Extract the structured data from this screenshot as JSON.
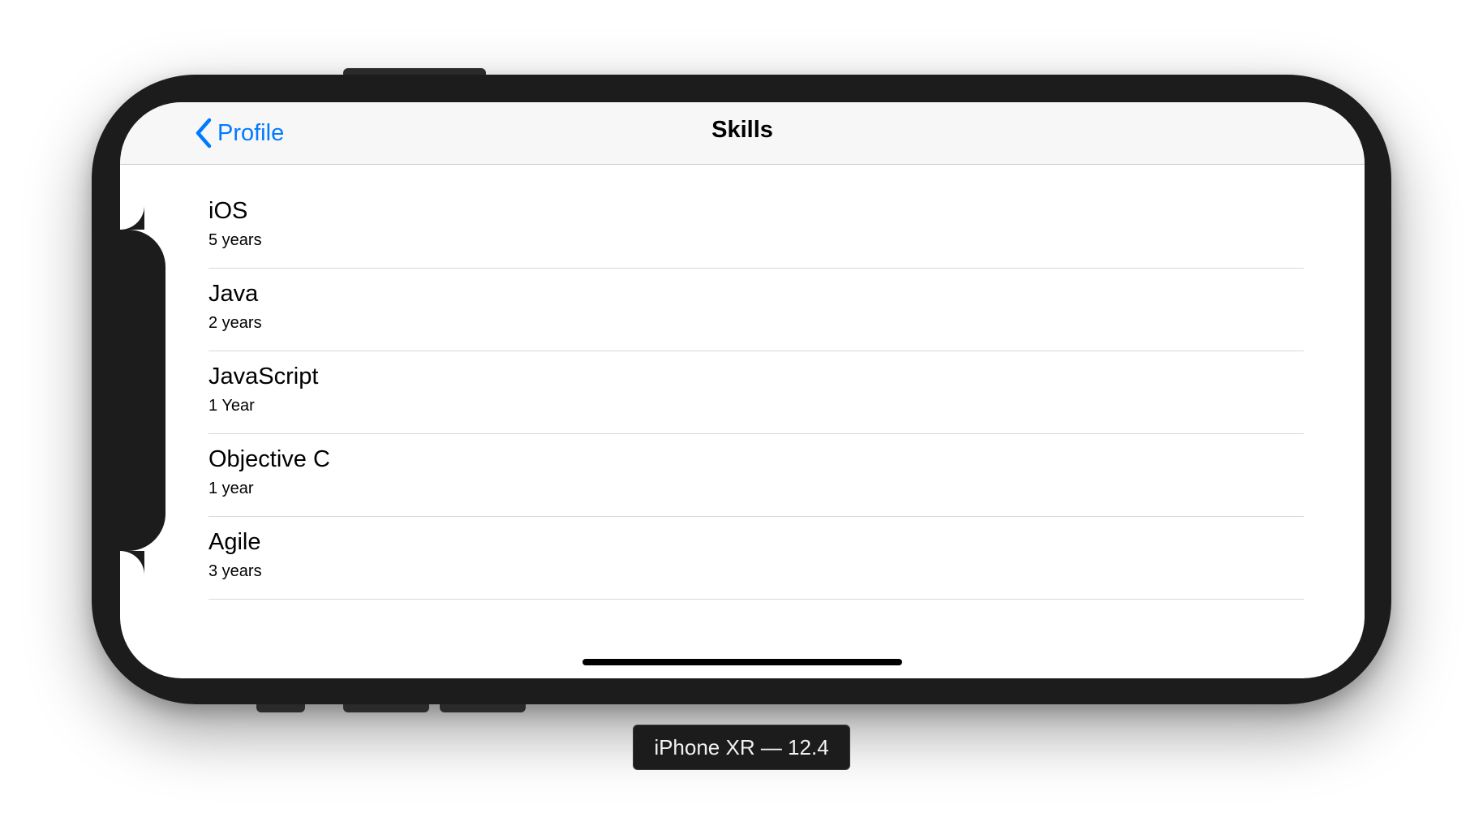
{
  "nav": {
    "back_label": "Profile",
    "title": "Skills"
  },
  "skills": [
    {
      "name": "iOS",
      "detail": "5 years"
    },
    {
      "name": "Java",
      "detail": "2 years"
    },
    {
      "name": "JavaScript",
      "detail": "1 Year"
    },
    {
      "name": "Objective C",
      "detail": "1 year"
    },
    {
      "name": "Agile",
      "detail": "3 years"
    }
  ],
  "device_label": "iPhone XR — 12.4",
  "colors": {
    "accent": "#007aff",
    "device_frame": "#1c1c1c",
    "navbar_bg": "#f7f7f7"
  },
  "icons": {
    "back": "chevron-left-icon"
  }
}
